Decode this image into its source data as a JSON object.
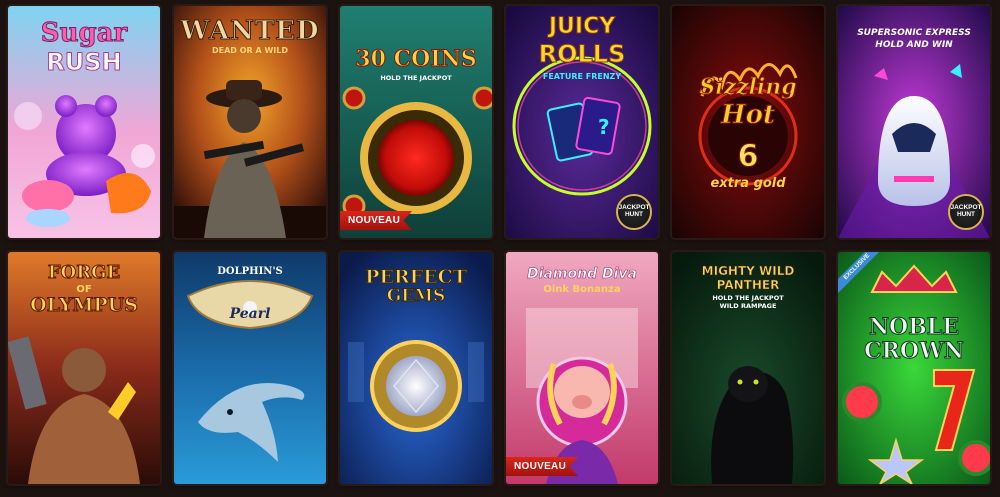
{
  "games": [
    {
      "title_line1": "Sugar",
      "title_line2": "RUSH",
      "badge": ""
    },
    {
      "title_line1": "WANTED",
      "title_line2": "DEAD OR A WILD",
      "badge": ""
    },
    {
      "title_line1": "30 COINS",
      "title_line2": "HOLD THE JACKPOT",
      "badge": "NOUVEAU"
    },
    {
      "title_line1": "JUICY",
      "title_line2": "ROLLS",
      "title_line3": "FEATURE FRENZY",
      "badge_jackpot": "JACKPOT HUNT"
    },
    {
      "title_line1": "Sizzling",
      "title_line2": "Hot",
      "title_line3": "6",
      "title_line4": "extra gold"
    },
    {
      "title_line1": "SUPERSONIC EXPRESS",
      "title_line2": "HOLD AND WIN",
      "badge_jackpot": "JACKPOT HUNT"
    },
    {
      "title_line1": "FORGE",
      "title_line2": "OF",
      "title_line3": "OLYMPUS"
    },
    {
      "title_line1": "DOLPHIN'S",
      "title_line2": "Pearl"
    },
    {
      "title_line1": "PERFECT",
      "title_line2": "GEMS"
    },
    {
      "title_line1": "Diamond Diva",
      "title_line2": "Oink Bonanza",
      "badge": "NOUVEAU"
    },
    {
      "title_line1": "MIGHTY WILD",
      "title_line2": "PANTHER",
      "title_line3": "HOLD THE JACKPOT",
      "title_line4": "WILD RAMPAGE"
    },
    {
      "title_line1": "NOBLE",
      "title_line2": "CROWN",
      "ribbon": "EXCLUSIVE"
    }
  ],
  "colors": {
    "background": "#1c1311",
    "badge_red": "#d9261c",
    "gold": "#d8b450"
  }
}
